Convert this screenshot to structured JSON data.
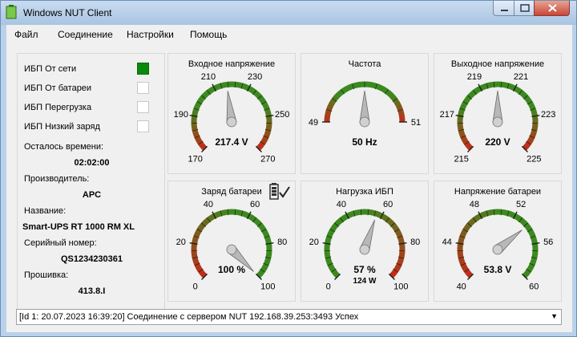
{
  "window": {
    "title": "Windows NUT Client"
  },
  "menu": [
    "Файл",
    "Соединение",
    "Настройки",
    "Помощь"
  ],
  "status_flags": [
    {
      "label": "ИБП От сети",
      "on": true
    },
    {
      "label": "ИБП От батареи",
      "on": false
    },
    {
      "label": "ИБП Перегрузка",
      "on": false
    },
    {
      "label": "ИБП Низкий заряд",
      "on": false
    }
  ],
  "info": {
    "time_label": "Осталось времени:",
    "time_value": "02:02:00",
    "manufacturer_label": "Производитель:",
    "manufacturer_value": "APC",
    "name_label": "Название:",
    "name_value": "Smart-UPS RT 1000 RM XL",
    "serial_label": "Серийный номер:",
    "serial_value": "QS1234230361",
    "firmware_label": "Прошивка:",
    "firmware_value": "413.8.I"
  },
  "gauges": [
    {
      "title": "Входное напряжение",
      "min": 170,
      "max": 270,
      "value": 217.4,
      "ticks": [
        "170",
        "190",
        "210",
        "230",
        "250",
        "270"
      ],
      "readout": "217.4 V",
      "sub": "",
      "scheme": "rggr"
    },
    {
      "title": "Частота",
      "min": 49,
      "max": 51,
      "value": 50,
      "ticks": [
        "49",
        "51"
      ],
      "readout": "50 Hz",
      "sub": "",
      "scheme": "rggr"
    },
    {
      "title": "Выходное напряжение",
      "min": 215,
      "max": 225,
      "value": 220,
      "ticks": [
        "215",
        "217",
        "219",
        "221",
        "223",
        "225"
      ],
      "readout": "220 V",
      "sub": "",
      "scheme": "rggr"
    },
    {
      "title": "Заряд батареи",
      "min": 0,
      "max": 100,
      "value": 100,
      "ticks": [
        "0",
        "20",
        "40",
        "60",
        "80",
        "100"
      ],
      "readout": "100 %",
      "sub": "",
      "scheme": "rg"
    },
    {
      "title": "Нагрузка ИБП",
      "min": 0,
      "max": 100,
      "value": 57,
      "ticks": [
        "0",
        "20",
        "40",
        "60",
        "80",
        "100"
      ],
      "readout": "57 %",
      "sub": "124 W",
      "scheme": "gr"
    },
    {
      "title": "Напряжение батареи",
      "min": 40,
      "max": 60,
      "value": 53.8,
      "ticks": [
        "40",
        "44",
        "48",
        "52",
        "56",
        "60"
      ],
      "readout": "53.8 V",
      "sub": "",
      "scheme": "rg"
    }
  ],
  "log": {
    "text": "[Id 1: 20.07.2023 16:39:20] Соединение с сервером NUT 192.168.39.253:3493 Успех"
  },
  "colors": {
    "green": "#3c8a1f",
    "red": "#c62a1a",
    "on": "#0a8a0a"
  }
}
